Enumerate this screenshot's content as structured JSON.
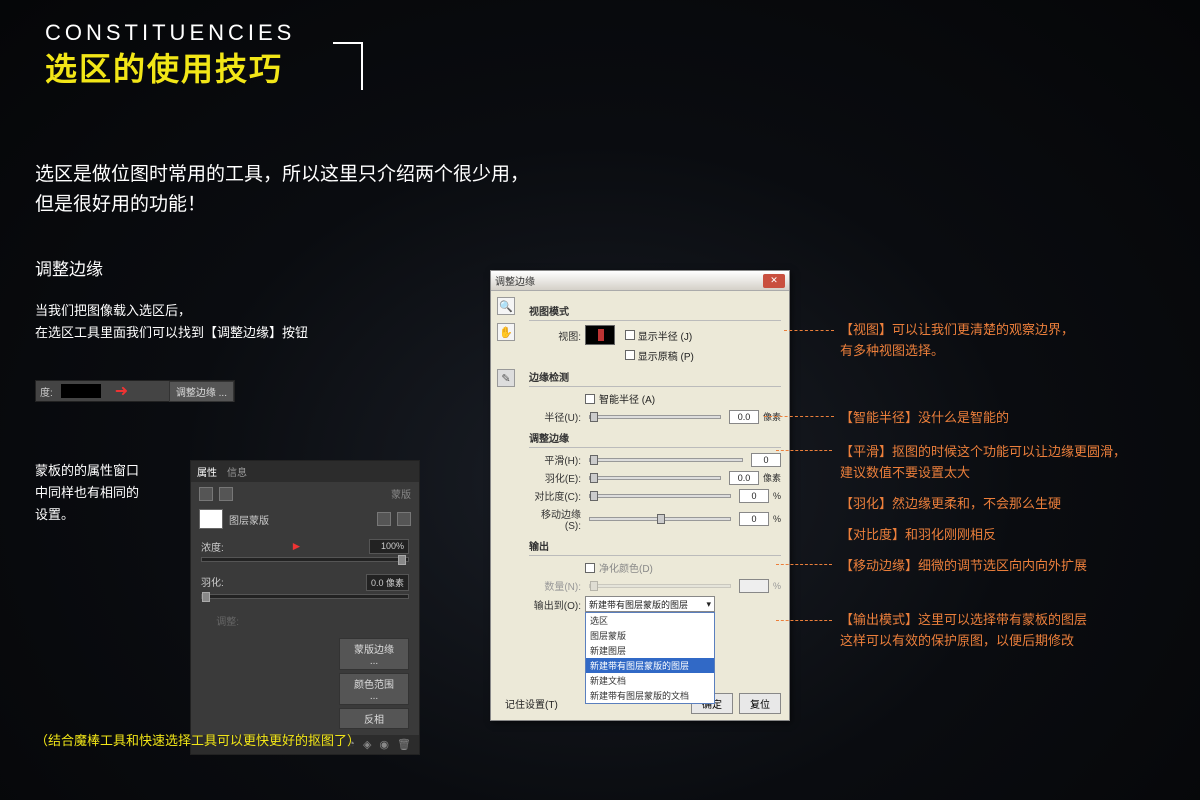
{
  "title": {
    "en": "CONSTITUENCIES",
    "cn": "选区的使用技巧"
  },
  "intro": {
    "l1": "选区是做位图时常用的工具，所以这里只介绍两个很少用，",
    "l2": "但是很好用的功能！"
  },
  "section_refine": "调整边缘",
  "desc1": {
    "l1": "当我们把图像载入选区后，",
    "l2": "在选区工具里面我们可以找到【调整边缘】按钮"
  },
  "smallbar": {
    "label": "度:",
    "btn": "调整边缘 ..."
  },
  "desc2": {
    "l1": "蒙板的的属性窗口",
    "l2": "中同样也有相同的",
    "l3": "设置。"
  },
  "mask_panel": {
    "tab1": "属性",
    "tab2": "信息",
    "type_label": "蒙版",
    "mask_name": "图层蒙版",
    "density": {
      "label": "浓度:",
      "value": "100%"
    },
    "feather": {
      "label": "羽化:",
      "value": "0.0 像素"
    },
    "adjust_label": "调整:",
    "btn_edge": "蒙版边缘 ...",
    "btn_color": "颜色范围 ...",
    "btn_invert": "反相"
  },
  "tip": "（结合魔棒工具和快速选择工具可以更快更好的抠图了）",
  "dialog": {
    "title": "调整边缘",
    "view_mode": "视图模式",
    "view_label": "视图:",
    "show_radius": "显示半径 (J)",
    "show_original": "显示原稿 (P)",
    "edge_detect": "边缘检测",
    "smart_radius": "智能半径 (A)",
    "radius": {
      "label": "半径(U):",
      "value": "0.0",
      "unit": "像素"
    },
    "adjust": "调整边缘",
    "smooth": {
      "label": "平滑(H):",
      "value": "0"
    },
    "feather": {
      "label": "羽化(E):",
      "value": "0.0",
      "unit": "像素"
    },
    "contrast": {
      "label": "对比度(C):",
      "value": "0",
      "unit": "%"
    },
    "shift": {
      "label": "移动边缘(S):",
      "value": "0",
      "unit": "%"
    },
    "output": "输出",
    "decontaminate": "净化颜色(D)",
    "amount": {
      "label": "数量(N):",
      "value": "",
      "unit": "%"
    },
    "output_to": "输出到(O):",
    "output_sel": "新建带有图层蒙版的图层",
    "options": [
      "选区",
      "图层蒙版",
      "新建图层",
      "新建带有图层蒙版的图层",
      "新建文档",
      "新建带有图层蒙版的文档"
    ],
    "remember": "记住设置(T)",
    "ok": "确定",
    "reset": "复位"
  },
  "annotations": {
    "a1": "【视图】可以让我们更清楚的观察边界，\n有多种视图选择。",
    "a2": "【智能半径】没什么是智能的",
    "a3": "【平滑】抠图的时候这个功能可以让边缘更圆滑，\n建议数值不要设置太大",
    "a4": "【羽化】然边缘更柔和，不会那么生硬",
    "a5": "【对比度】和羽化刚刚相反",
    "a6": "【移动边缘】细微的调节选区向内向外扩展",
    "a7": "【输出模式】这里可以选择带有蒙板的图层\n这样可以有效的保护原图，以便后期修改"
  }
}
